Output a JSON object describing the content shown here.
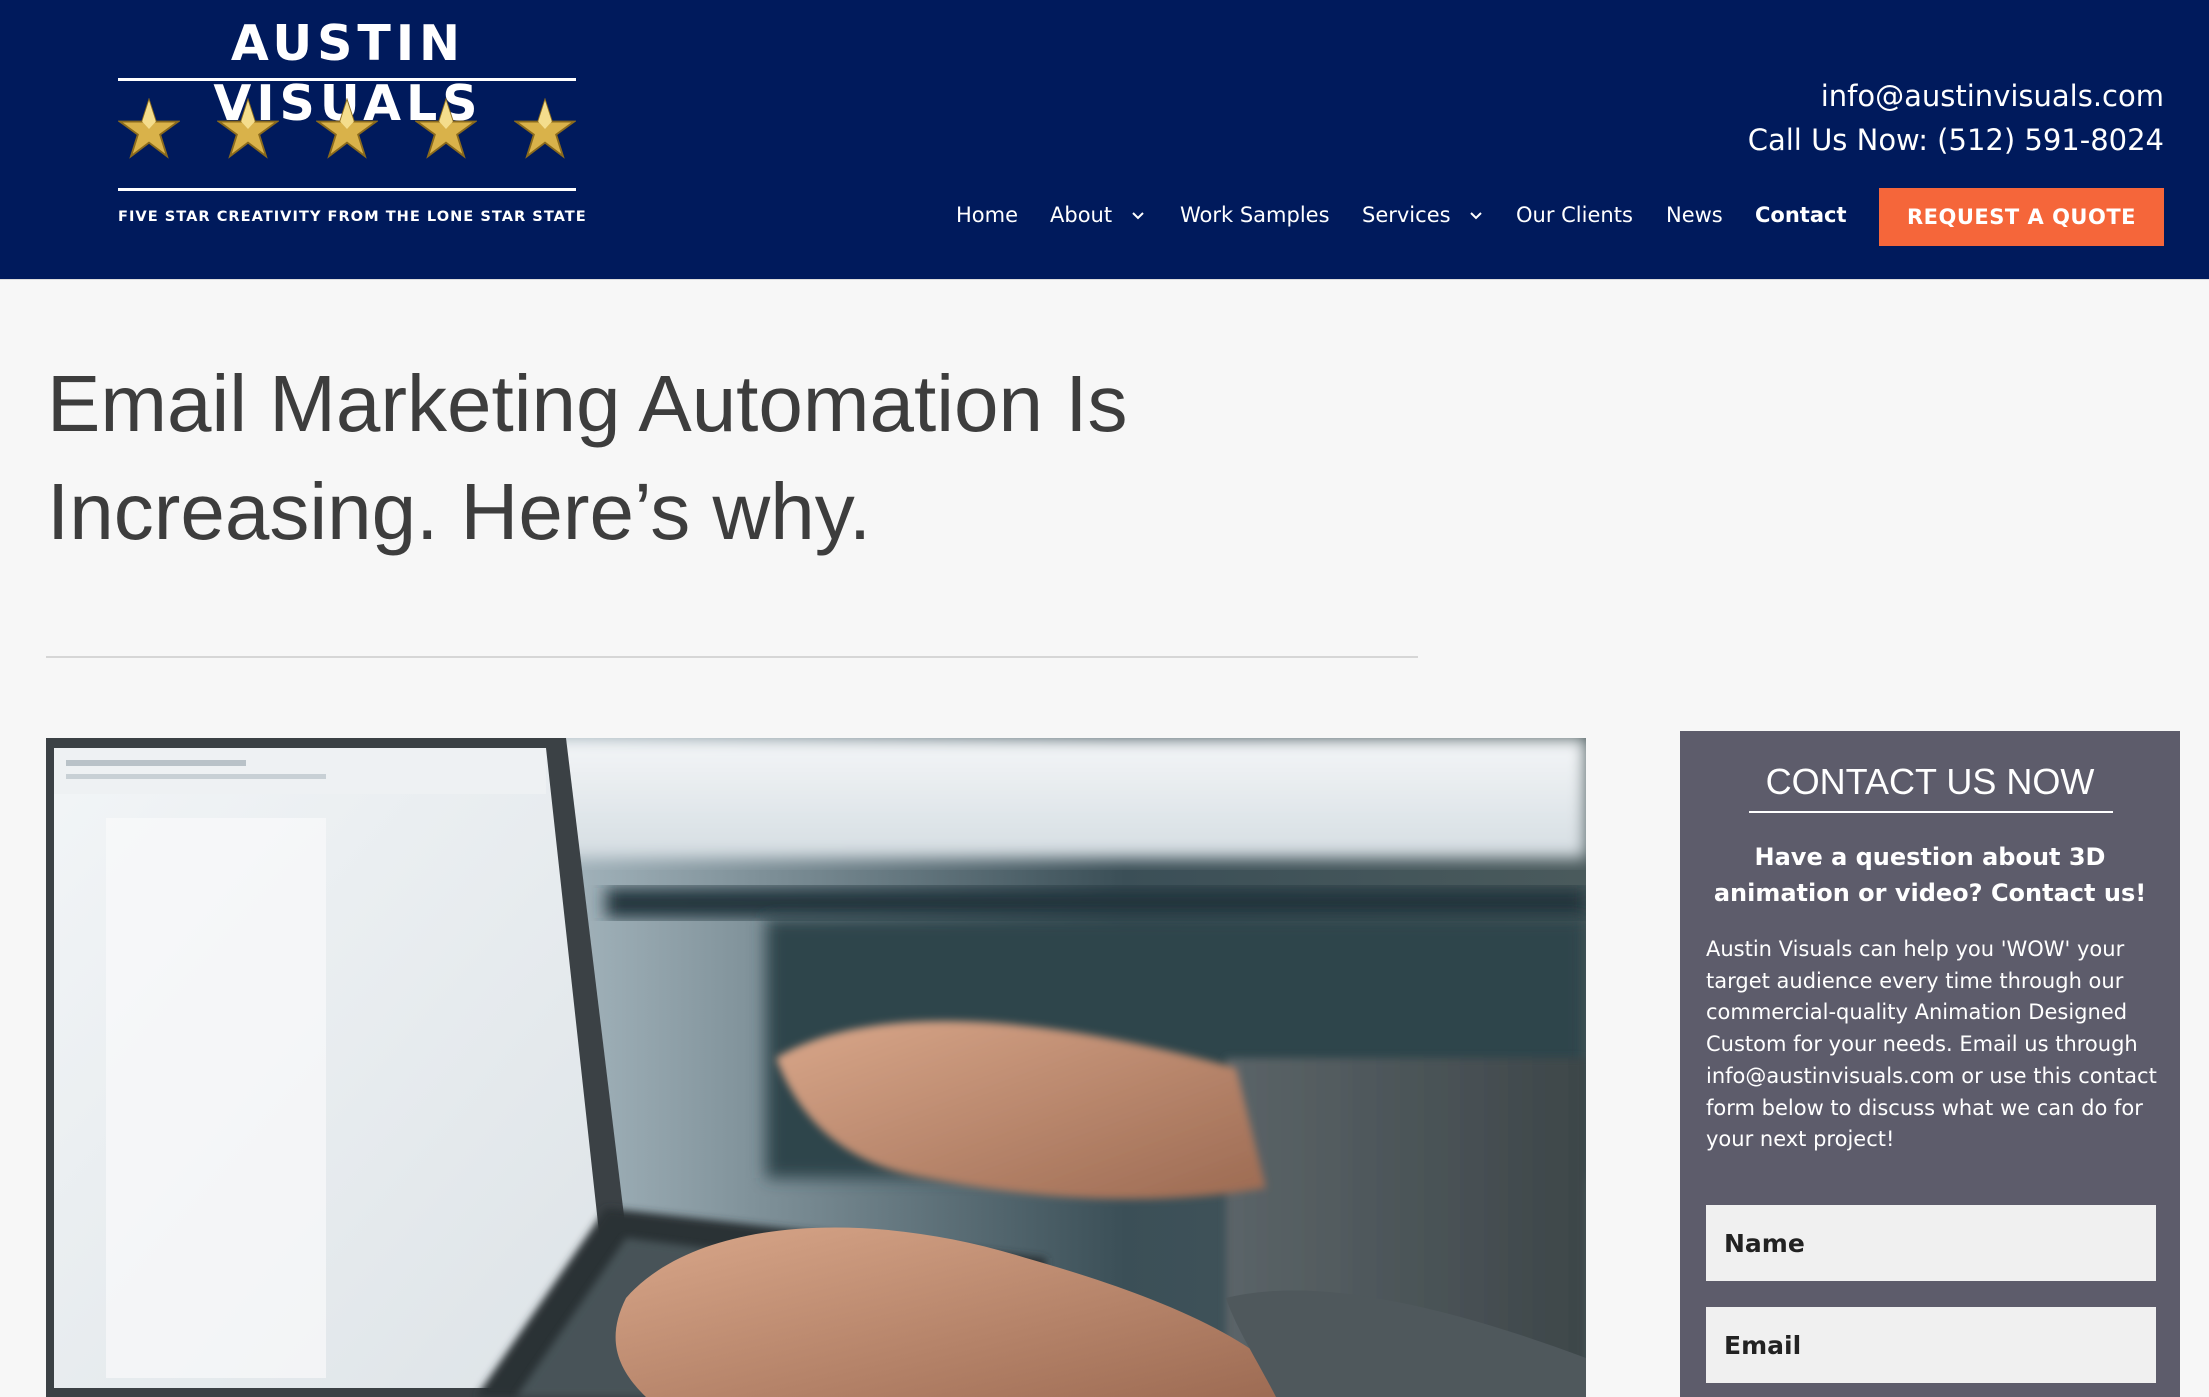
{
  "brand": {
    "name": "AUSTIN VISUALS",
    "tagline": "FIVE STAR CREATIVITY FROM THE LONE STAR STATE",
    "star_count": 5,
    "header_bg": "#001a5c",
    "star_color": "#d9b24a"
  },
  "contact": {
    "email": "info@austinvisuals.com",
    "phone": "Call Us Now: (512) 591-8024"
  },
  "nav": {
    "items": [
      {
        "label": "Home"
      },
      {
        "label": "About",
        "has_dropdown": true
      },
      {
        "label": "Work Samples"
      },
      {
        "label": "Services",
        "has_dropdown": true
      },
      {
        "label": "Our Clients"
      },
      {
        "label": "News"
      },
      {
        "label": "Contact",
        "active": true
      }
    ],
    "cta": "REQUEST A QUOTE",
    "cta_color": "#f5663a"
  },
  "article": {
    "title": "Email Marketing Automation Is Increasing. Here’s why.",
    "hero_image": "photo-hands-typing-on-laptop"
  },
  "sidebar": {
    "title": "CONTACT US NOW",
    "subtitle": "Have a question about 3D animation or video? Contact us!",
    "body": "Austin Visuals can help you 'WOW' your target audience every time through our commercial-quality Animation Designed Custom for your needs. Email us through info@austinvisuals.com or use this contact form below to discuss what we can do for your next project!",
    "name_placeholder": "Name",
    "email_placeholder": "Email",
    "bg": "#5d5c6b"
  }
}
